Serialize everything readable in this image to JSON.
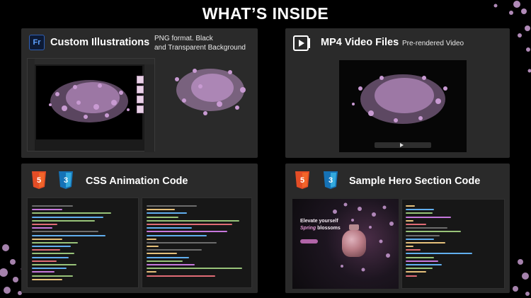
{
  "title": "WHAT’S INSIDE",
  "illustrations": {
    "icon_label": "Fr",
    "title": "Custom Illustrations",
    "subtitle_line1": "PNG format. Black",
    "subtitle_line2": "and Transparent Background"
  },
  "video": {
    "title": "MP4 Video Files",
    "subtitle": "Pre-rendered Video"
  },
  "css_code": {
    "title": "CSS Animation Code"
  },
  "hero": {
    "title": "Sample Hero Section Code",
    "preview_line1": "Elevate yourself",
    "preview_line2_accent": "Spring",
    "preview_line2_rest": " blossoms"
  },
  "colors": {
    "petal": "#c79ad4",
    "html5": "#e44d26",
    "css3": "#264de4",
    "card": "#2a2a2a"
  },
  "icons": [
    "fresco-icon",
    "video-play-icon",
    "html5-icon",
    "css3-icon"
  ]
}
